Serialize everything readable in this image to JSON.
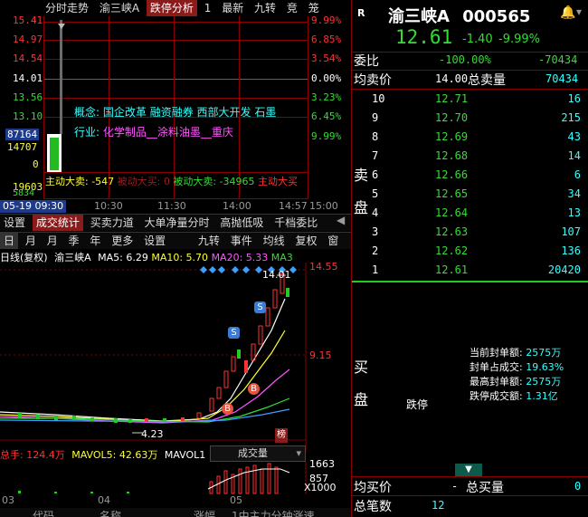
{
  "intraday": {
    "tabs": [
      "分时走势",
      "渝三峡A",
      "跌停分析",
      "1",
      "最新",
      "九转",
      "竞",
      "笼"
    ],
    "left_axis": [
      "15.41",
      "14.97",
      "14.54",
      "14.01",
      "13.56",
      "13.10",
      "87164",
      "14707",
      "0",
      "19603",
      "5834"
    ],
    "right_axis": [
      "9.99%",
      "6.85%",
      "3.54%",
      "0.00%",
      "3.23%",
      "6.45%",
      "9.99%"
    ],
    "concept_label": "概念:",
    "concepts": "国企改革 融资融券 西部大开发 石墨",
    "industry_label": "行业:",
    "industry": "化学制品__涂料油墨__重庆",
    "flow": {
      "active_buy": "主动大卖: -547",
      "passive_buy": "被动大买: 0",
      "passive_sell": "被动大卖: -34965",
      "active_sell": "主动大买"
    },
    "date_time": "05-19 09:30",
    "times": [
      "10:30",
      "11:30",
      "14:00",
      "14:57",
      "15:00"
    ]
  },
  "toolbar1": [
    "设置",
    "成交统计",
    "买卖力道",
    "大单净量分时",
    "高抛低吸",
    "千档委比"
  ],
  "toolbar2": [
    "日",
    "月",
    "月",
    "季",
    "年",
    "更多",
    "设置",
    "九转",
    "事件",
    "均线",
    "复权",
    "窗"
  ],
  "daily": {
    "header_prefix": "日线(复权)",
    "header_name": "渝三峡A",
    "ma5": "MA5: 6.29",
    "ma10": "MA10: 5.70",
    "ma20": "MA20: 5.33",
    "ma_more": "MA3",
    "high_label": "14.01",
    "axis_top": "14.55",
    "axis_mid": "9.15",
    "low_label": "4.23",
    "buy_marker": "B",
    "sell_marker": "S",
    "list_badge": "榜",
    "volume_header": {
      "total": "总手: 124.4万",
      "mavol5": "MAVOL5: 42.63万",
      "mavol10": "MAVOL1",
      "selector": "成交量"
    },
    "volume_axis": [
      "1663",
      "857",
      "X1000"
    ],
    "months": [
      "03",
      "04",
      "05"
    ],
    "footer": [
      "代码",
      "名称",
      "涨幅",
      "1中主力分钟涨速"
    ]
  },
  "quote": {
    "r_badge": "R",
    "name": "渝三峡A",
    "code": "000565",
    "price": "12.61",
    "change": "-1.40",
    "change_pct": "-9.99%",
    "wei_bi_label": "委比",
    "wei_bi": "-100.00%",
    "wei_cha": "-70434",
    "avg_label": "均卖价",
    "avg_value": "14.00",
    "total_label": "总卖量",
    "total_value": "70434",
    "sell_side_label": [
      "卖",
      "盘"
    ],
    "asks": [
      {
        "level": "10",
        "price": "12.71",
        "vol": "16"
      },
      {
        "level": "9",
        "price": "12.70",
        "vol": "215"
      },
      {
        "level": "8",
        "price": "12.69",
        "vol": "43"
      },
      {
        "level": "7",
        "price": "12.68",
        "vol": "14"
      },
      {
        "level": "6",
        "price": "12.66",
        "vol": "6"
      },
      {
        "level": "5",
        "price": "12.65",
        "vol": "34"
      },
      {
        "level": "4",
        "price": "12.64",
        "vol": "13"
      },
      {
        "level": "3",
        "price": "12.63",
        "vol": "107"
      },
      {
        "level": "2",
        "price": "12.62",
        "vol": "136"
      },
      {
        "level": "1",
        "price": "12.61",
        "vol": "20420"
      }
    ],
    "buy_side_label": [
      "买",
      "盘"
    ],
    "limit_down": "跌停",
    "seal_stats": [
      {
        "label": "当前封单额:",
        "value": "2575万"
      },
      {
        "label": "封单占成交:",
        "value": "19.63%"
      },
      {
        "label": "最高封单额:",
        "value": "2575万"
      },
      {
        "label": "跌停成交额:",
        "value": "1.31亿"
      }
    ],
    "avg_buy_label": "均买价",
    "avg_buy_value": "-",
    "total_buy_label": "总买量",
    "total_buy_value": "0",
    "total_trades_label": "总笔数",
    "total_trades_value": "12"
  }
}
